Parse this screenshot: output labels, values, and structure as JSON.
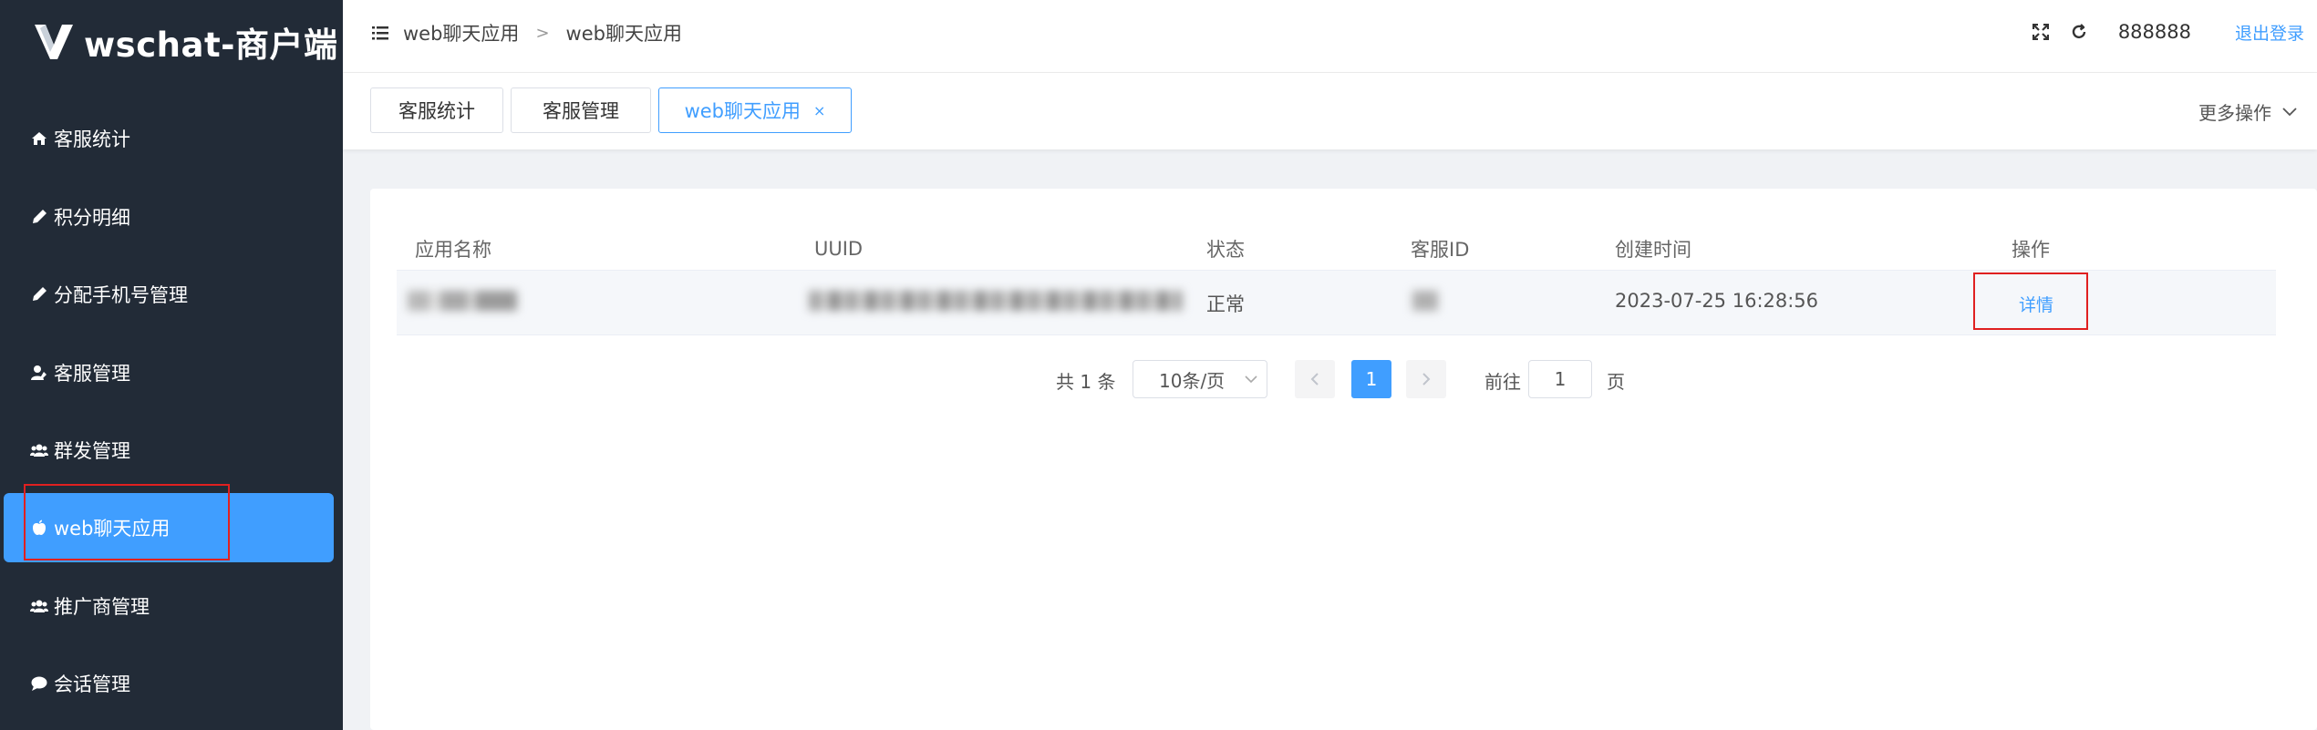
{
  "sidebar": {
    "logo_text": "wschat-商户端",
    "items": [
      {
        "label": "客服统计",
        "icon": "home-icon"
      },
      {
        "label": "积分明细",
        "icon": "pen-icon"
      },
      {
        "label": "分配手机号管理",
        "icon": "pen-icon"
      },
      {
        "label": "客服管理",
        "icon": "user-edit-icon"
      },
      {
        "label": "群发管理",
        "icon": "users-icon"
      },
      {
        "label": "web聊天应用",
        "icon": "apple-icon",
        "active": true
      },
      {
        "label": "推广商管理",
        "icon": "users-icon"
      },
      {
        "label": "会话管理",
        "icon": "chat-icon"
      }
    ]
  },
  "header": {
    "breadcrumb": [
      "web聊天应用",
      "web聊天应用"
    ],
    "breadcrumb_sep": ">",
    "username": "888888",
    "logout": "退出登录"
  },
  "tabs": {
    "items": [
      {
        "label": "客服统计"
      },
      {
        "label": "客服管理"
      },
      {
        "label": "web聊天应用",
        "active": true,
        "close": "×"
      }
    ],
    "more_ops": "更多操作"
  },
  "table": {
    "columns": [
      "应用名称",
      "UUID",
      "状态",
      "客服ID",
      "创建时间",
      "操作"
    ],
    "rows": [
      {
        "status": "正常",
        "created": "2023-07-25 16:28:56",
        "action": "详情"
      }
    ]
  },
  "pagination": {
    "total": "共 1 条",
    "page_size": "10条/页",
    "current_page": "1",
    "goto_label": "前往",
    "goto_value": "1",
    "page_suffix": "页"
  },
  "colors": {
    "sidebar_bg": "#222b37",
    "accent": "#409eff",
    "highlight_box": "#e02020"
  }
}
